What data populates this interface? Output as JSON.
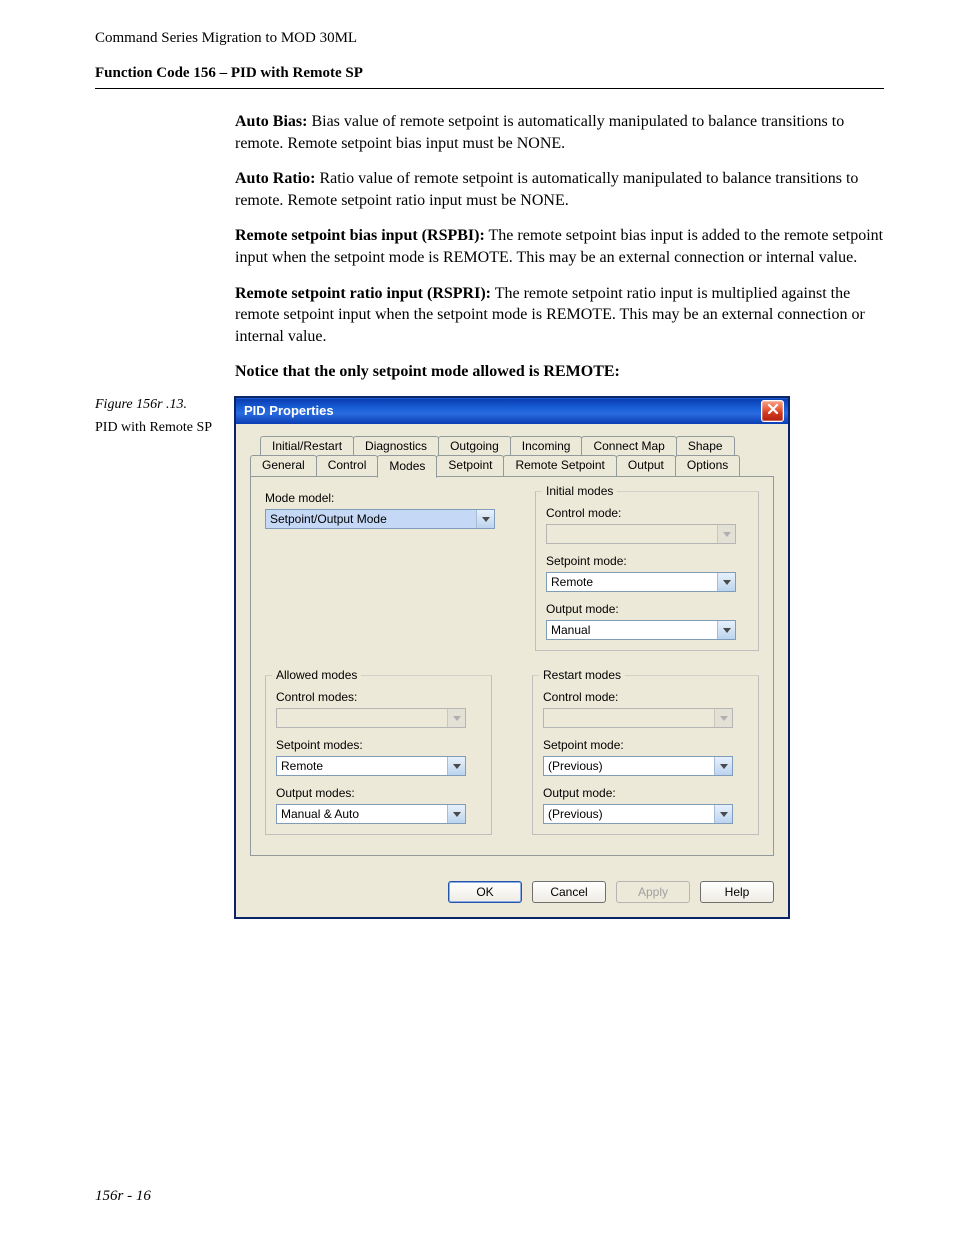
{
  "header": {
    "running": "Command Series Migration to MOD 30ML",
    "section": "Function Code 156 – PID with Remote SP"
  },
  "paragraphs": {
    "p1_b": "Auto Bias:",
    "p1": "  Bias value of remote setpoint is automatically manipulated to balance transitions to remote.  Remote setpoint bias input must be NONE.",
    "p2_b": "Auto Ratio:",
    "p2": "  Ratio value of remote setpoint is automatically manipulated to balance transitions to remote.  Remote setpoint ratio input must be NONE.",
    "p3_b": "Remote setpoint bias input (RSPBI):",
    "p3": " The remote setpoint bias input is added to the remote setpoint input when the setpoint mode is REMOTE. This may be an external connection or internal value.",
    "p4_b": "Remote setpoint ratio input (RSPRI):",
    "p4": " The remote setpoint ratio input is multiplied against the remote setpoint input when the setpoint mode is REMOTE. This may be an external connection or internal value.",
    "notice": "Notice that the only setpoint mode allowed is REMOTE:"
  },
  "figure": {
    "label": "Figure 156r .13.",
    "caption": "PID with Remote SP"
  },
  "dialog": {
    "title": "PID Properties",
    "tabs_back": [
      "Initial/Restart",
      "Diagnostics",
      "Outgoing",
      "Incoming",
      "Connect Map",
      "Shape"
    ],
    "tabs_front": [
      "General",
      "Control",
      "Modes",
      "Setpoint",
      "Remote Setpoint",
      "Output",
      "Options"
    ],
    "active_tab": "Modes",
    "mode_model": {
      "label": "Mode model:",
      "value": "Setpoint/Output Mode"
    },
    "initial": {
      "legend": "Initial modes",
      "control_label": "Control mode:",
      "control_value": "",
      "setpoint_label": "Setpoint mode:",
      "setpoint_value": "Remote",
      "output_label": "Output mode:",
      "output_value": "Manual"
    },
    "allowed": {
      "legend": "Allowed modes",
      "control_label": "Control modes:",
      "control_value": "",
      "setpoint_label": "Setpoint modes:",
      "setpoint_value": "Remote",
      "output_label": "Output modes:",
      "output_value": "Manual & Auto"
    },
    "restart": {
      "legend": "Restart modes",
      "control_label": "Control mode:",
      "control_value": "",
      "setpoint_label": "Setpoint mode:",
      "setpoint_value": "(Previous)",
      "output_label": "Output mode:",
      "output_value": "(Previous)"
    },
    "buttons": {
      "ok": "OK",
      "cancel": "Cancel",
      "apply": "Apply",
      "help": "Help"
    }
  },
  "footer": {
    "page": "156r - 16"
  }
}
